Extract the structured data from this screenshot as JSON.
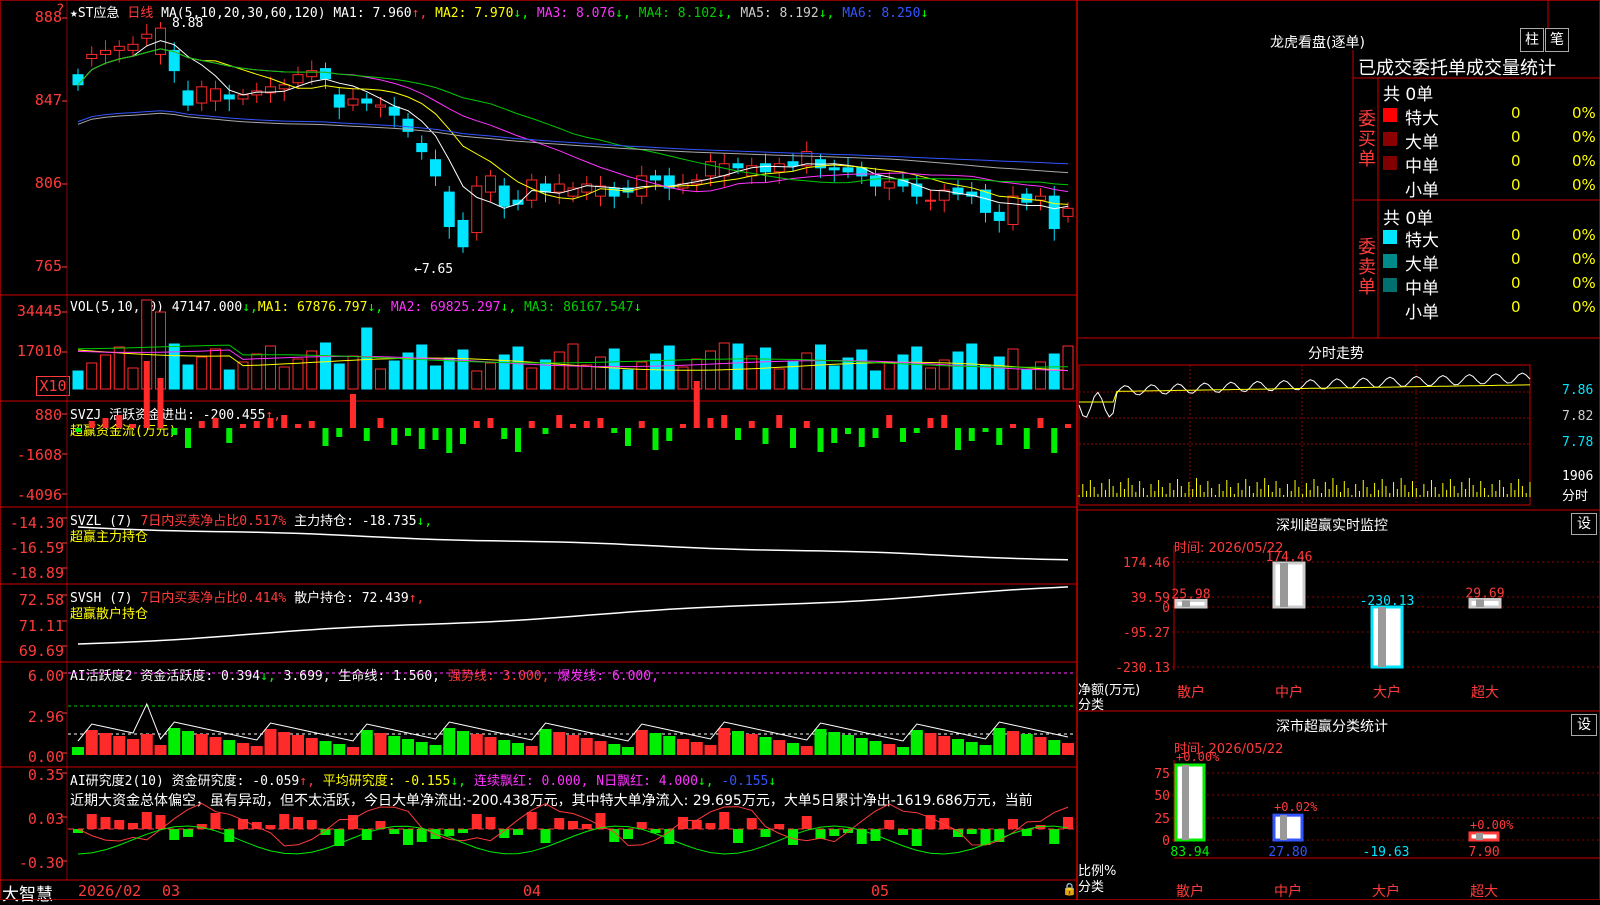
{
  "app": {
    "logo": "大智慧",
    "corner_mark": "?"
  },
  "colors": {
    "up": "#ff2a2a",
    "down": "#00e5ff",
    "ma1": "#ffffff",
    "ma2": "#ffff00",
    "ma3": "#ff33ff",
    "ma4": "#00cc00",
    "ma5": "#aaaaaa",
    "ma6": "#3355ff",
    "grid": "#8b0000",
    "axis_text": "#ff3b3b"
  },
  "main": {
    "star": "★",
    "stock": "ST应急",
    "period": "日线",
    "ma_label": "MA(5,10,20,30,60,120)",
    "ma1_label": "MA1: 7.960",
    "ma1_arrow": "↑,",
    "ma2_label": "MA2: 7.970",
    "ma2_arrow": "↓,",
    "ma3_label": "MA3: 8.076",
    "ma3_arrow": "↓,",
    "ma4_label": "MA4: 8.102",
    "ma4_arrow": "↓,",
    "ma5_label": "MA5: 8.192",
    "ma5_arrow": "↓,",
    "ma6_label": "MA6: 8.250",
    "ma6_arrow": "↓",
    "y_ticks": [
      "888",
      "847",
      "806",
      "765"
    ],
    "high_annotation": "8.88",
    "low_annotation": "←7.65"
  },
  "vol": {
    "label": "VOL(5,10,20)",
    "value": "47147.000",
    "ma1": "MA1: 67876.797",
    "ma2": "MA2: 69825.297",
    "ma3": "MA3: 86167.547",
    "y_ticks": [
      "34445",
      "17010"
    ],
    "unit": "X10"
  },
  "svzj": {
    "label": "SVZJ",
    "desc": "活跃资金进出: -200.455",
    "arrow": "↑,",
    "subtitle": "超赢资金流(万元)",
    "y_ticks": [
      "880",
      "-1608",
      "-4096"
    ]
  },
  "svzl": {
    "label": "SVZL (7)",
    "desc": "7日内买卖净占比0.517%",
    "desc2": "主力持仓: -18.735",
    "arrow": "↓,",
    "subtitle": "超赢主力持仓",
    "y_ticks": [
      "-14.30",
      "-16.59",
      "-18.89"
    ]
  },
  "svsh": {
    "label": "SVSH (7)",
    "desc": "7日内买卖净占比0.414%",
    "desc2": "散户持仓: 72.439",
    "arrow": "↑,",
    "subtitle": "超赢散户持仓",
    "y_ticks": [
      "72.58",
      "71.11",
      "69.69"
    ]
  },
  "ai1": {
    "label": "AI活跃度2",
    "a": "资金活跃度: 0.394",
    "a_arrow": "↓,",
    "b": "3.699,",
    "c": "生命线: 1.560,",
    "d": "强势线: 3.000,",
    "e": "爆发线: 6.000,",
    "y_ticks": [
      "6.00",
      "2.96",
      "0.00"
    ]
  },
  "ai2": {
    "label": "AI研究度2(10)",
    "a": "资金研究度: -0.059",
    "a_arrow": "↑,",
    "b": "平均研究度: -0.155",
    "b_arrow": "↓,",
    "c": "连续飘红: 0.000,",
    "d": "N日飘红: 4.000",
    "d_arrow": "↓,",
    "e": "-0.155",
    "e_arrow": "↓",
    "commentary": "近期大资金总体偏空，虽有异动，但不太活跃，今日大单净流出:-200.438万元，其中特大单净流入: 29.695万元，大单5日累计净出-1619.686万元，当前",
    "y_ticks": [
      "0.35",
      "0.03",
      "-0.30"
    ]
  },
  "xaxis": {
    "labels": [
      "2026/02",
      "03",
      "04",
      "05"
    ]
  },
  "lhb": {
    "title": "龙虎看盘(逐单)",
    "btn_zhu": "柱",
    "btn_bi": "笔",
    "header": "已成交委托单成交量统计",
    "buy_side": "委买单",
    "sell_side": "委卖单",
    "buy_total": "共 0单",
    "sell_total": "共 0单",
    "buy_rows": [
      {
        "name": "特大",
        "count": "0",
        "pct": "0%"
      },
      {
        "name": "大单",
        "count": "0",
        "pct": "0%"
      },
      {
        "name": "中单",
        "count": "0",
        "pct": "0%"
      },
      {
        "name": "小单",
        "count": "0",
        "pct": "0%"
      }
    ],
    "sell_rows": [
      {
        "name": "特大",
        "count": "0",
        "pct": "0%"
      },
      {
        "name": "大单",
        "count": "0",
        "pct": "0%"
      },
      {
        "name": "中单",
        "count": "0",
        "pct": "0%"
      },
      {
        "name": "小单",
        "count": "0",
        "pct": "0%"
      }
    ]
  },
  "intraday": {
    "title": "分时走势",
    "price_ticks": [
      "7.86",
      "7.82",
      "7.78"
    ],
    "vol_tick": "1906",
    "vol_label": "分时"
  },
  "sz_monitor": {
    "title": "深圳超赢实时监控",
    "btn": "设",
    "time": "时间: 2026/05/22",
    "y_ticks": [
      "174.46",
      "39.59",
      "0",
      "-95.27",
      "-230.13"
    ],
    "side_label1": "净额(万元)",
    "side_label2": "分类",
    "categories": [
      "散户",
      "中户",
      "大户",
      "超大"
    ],
    "values": [
      25.98,
      174.46,
      -230.13,
      29.69
    ],
    "value_labels": [
      "25.98",
      "174.46",
      "-230.13",
      "29.69"
    ]
  },
  "sz_class": {
    "title": "深市超赢分类统计",
    "btn": "设",
    "time": "时间: 2026/05/22",
    "y_ticks": [
      "75",
      "50",
      "25",
      "0"
    ],
    "side_label1": "比例%",
    "side_label2": "分类",
    "categories": [
      "散户",
      "中户",
      "大户",
      "超大"
    ],
    "bar_values": [
      83.94,
      27.8,
      0,
      7.9
    ],
    "top_labels": [
      "+0.00%",
      "+0.02%",
      "",
      "+0.00%"
    ],
    "bottom_labels": [
      "83.94",
      "27.80",
      "-19.63",
      "7.90"
    ]
  },
  "chart_data": {
    "type": "candlestick",
    "title": "ST应急 日线",
    "ylim": [
      7.6,
      8.9
    ],
    "high": 8.88,
    "low": 7.65,
    "x_labels": [
      "2026/02",
      "03",
      "04",
      "05"
    ],
    "closes": [
      8.55,
      8.7,
      8.72,
      8.74,
      8.75,
      8.8,
      8.83,
      8.62,
      8.45,
      8.54,
      8.53,
      8.48,
      8.5,
      8.52,
      8.54,
      8.55,
      8.6,
      8.62,
      8.58,
      8.44,
      8.48,
      8.46,
      8.45,
      8.4,
      8.32,
      8.22,
      8.1,
      7.85,
      7.75,
      8.05,
      8.1,
      7.95,
      7.96,
      8.08,
      8.02,
      8.06,
      8.04,
      8.06,
      8.05,
      8.0,
      8.02,
      8.1,
      8.08,
      8.04,
      8.06,
      8.08,
      8.17,
      8.16,
      8.14,
      8.15,
      8.12,
      8.16,
      8.15,
      8.22,
      8.14,
      8.13,
      8.12,
      8.1,
      8.05,
      8.07,
      8.05,
      8.0,
      7.98,
      8.03,
      8.01,
      8.0,
      7.92,
      7.88,
      8.0,
      7.97,
      8.0,
      7.84,
      7.94
    ],
    "opens": [
      8.6,
      8.68,
      8.7,
      8.72,
      8.72,
      8.78,
      8.7,
      8.72,
      8.52,
      8.46,
      8.47,
      8.5,
      8.48,
      8.5,
      8.51,
      8.53,
      8.56,
      8.59,
      8.63,
      8.5,
      8.45,
      8.48,
      8.44,
      8.44,
      8.38,
      8.26,
      8.18,
      8.02,
      7.88,
      7.82,
      8.02,
      8.05,
      7.98,
      7.98,
      8.06,
      8.02,
      8.0,
      8.02,
      8.0,
      8.04,
      8.04,
      8.0,
      8.1,
      8.1,
      8.04,
      8.06,
      8.1,
      8.1,
      8.16,
      8.1,
      8.16,
      8.12,
      8.17,
      8.15,
      8.18,
      8.14,
      8.14,
      8.14,
      8.1,
      8.04,
      8.08,
      8.06,
      7.98,
      7.98,
      8.04,
      8.02,
      8.03,
      7.92,
      7.86,
      8.01,
      7.98,
      8.0,
      7.9
    ],
    "ma_lines": [
      "MA1",
      "MA2",
      "MA3",
      "MA4",
      "MA5",
      "MA6"
    ],
    "vol_series": {
      "name": "VOL",
      "last": 47147.0
    },
    "ai_activity_series": {
      "name": "资金活跃度",
      "last": 0.394
    },
    "ai_research_series": {
      "name": "资金研究度",
      "last": -0.059
    }
  }
}
